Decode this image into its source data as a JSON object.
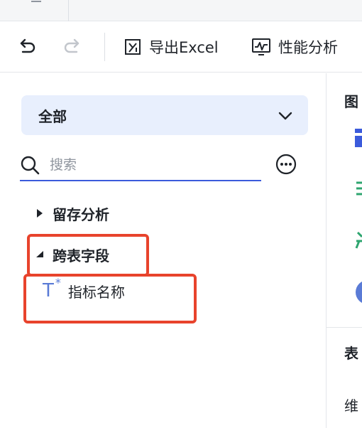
{
  "toolbar": {
    "undo_icon": "undo-icon",
    "redo_icon": "redo-icon",
    "export_label": "导出Excel",
    "export_icon": "export-excel-icon",
    "performance_label": "性能分析",
    "performance_icon": "performance-chart-icon"
  },
  "left_panel": {
    "dropdown": {
      "selected": "全部"
    },
    "search": {
      "placeholder": "搜索"
    },
    "tree": [
      {
        "label": "留存分析",
        "expanded": false
      },
      {
        "label": "跨表字段",
        "expanded": true,
        "children": [
          {
            "label": "指标名称",
            "type_icon": "T"
          }
        ]
      }
    ]
  },
  "right_panel": {
    "chart_heading": "图",
    "table_heading": "表",
    "dimension_label": "维"
  },
  "colors": {
    "accent": "#3b5bdb",
    "dropdown_bg": "#e8effd",
    "highlight": "#e8432c",
    "field_icon": "#5a7bd6"
  }
}
